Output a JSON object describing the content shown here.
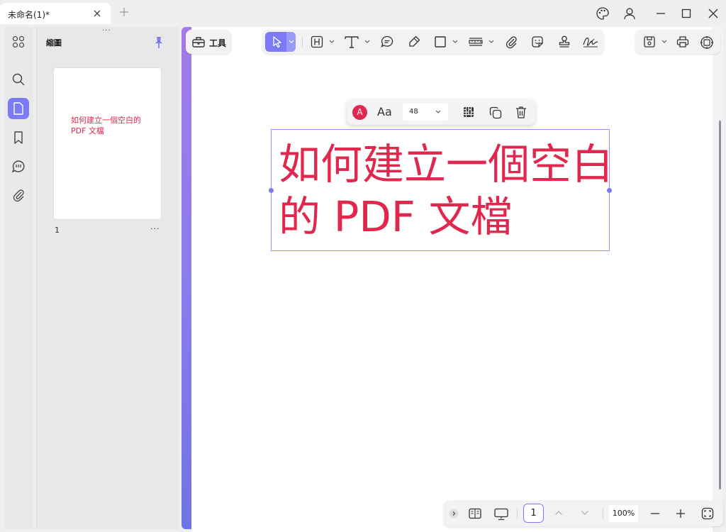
{
  "tab": {
    "title": "未命名(1)*"
  },
  "panel": {
    "title": "縮圖",
    "page_number": "1",
    "thumb_text": "如何建立一個空白的 PDF 文檔"
  },
  "toolbar": {
    "tools_label": "工具"
  },
  "text_toolbar": {
    "color_glyph": "A",
    "font_glyph": "Aa",
    "font_size": "48"
  },
  "document": {
    "line1": "如何建立一個空白",
    "line2": "的 PDF 文檔"
  },
  "bottom": {
    "page_input": "1",
    "zoom": "100%"
  },
  "colors": {
    "accent": "#7b7cf5",
    "text_red": "#e0284e",
    "gradient_top": "#a47ae8",
    "gradient_bottom": "#6f73e4"
  }
}
